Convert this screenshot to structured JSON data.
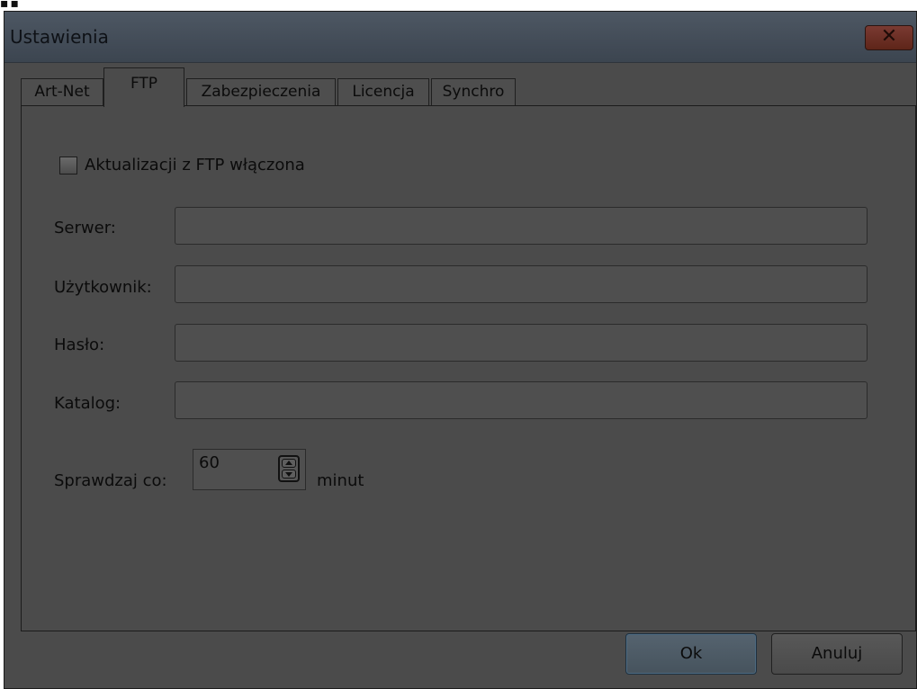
{
  "window": {
    "title": "Ustawienia",
    "close_glyph": "✕"
  },
  "tabs": [
    {
      "label": "Art-Net",
      "active": false
    },
    {
      "label": "FTP",
      "active": true
    },
    {
      "label": "Zabezpieczenia",
      "active": false
    },
    {
      "label": "Licencja",
      "active": false
    },
    {
      "label": "Synchro",
      "active": false
    }
  ],
  "ftp": {
    "enable_checkbox": {
      "label": "Aktualizacji z FTP włączona",
      "checked": false
    },
    "server": {
      "label": "Serwer:",
      "value": ""
    },
    "user": {
      "label": "Użytkownik:",
      "value": ""
    },
    "password": {
      "label": "Hasło:",
      "value": ""
    },
    "directory": {
      "label": "Katalog:",
      "value": ""
    },
    "interval": {
      "label": "Sprawdzaj co:",
      "value": "60",
      "unit": "minut"
    }
  },
  "buttons": {
    "ok": "Ok",
    "cancel": "Anuluj"
  },
  "colors": {
    "window_bg": "#4b4b4b",
    "close_button": "#6e3227",
    "ok_button_accent": "#4e6a80"
  },
  "icons": {
    "close": "close-icon",
    "spin_up": "arrow-up-icon",
    "spin_down": "arrow-down-icon"
  }
}
